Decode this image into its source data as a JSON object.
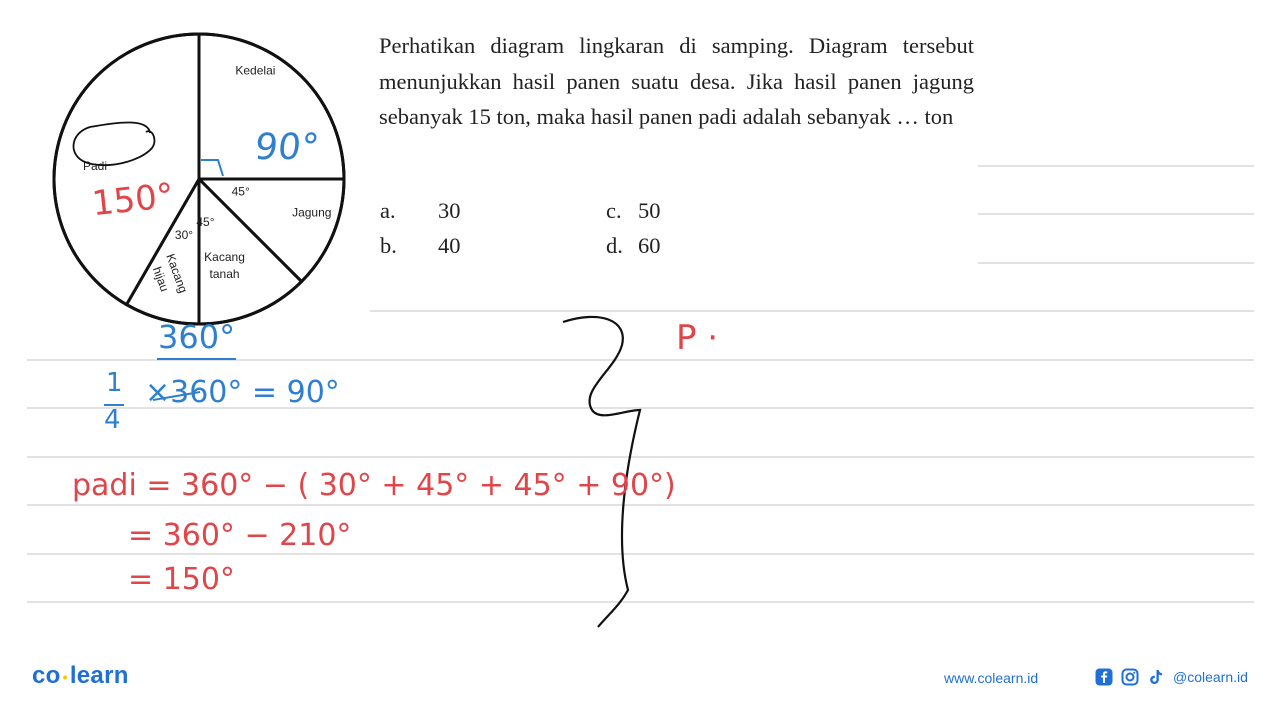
{
  "question": {
    "text": "Perhatikan diagram lingkaran di samping. Diagram tersebut menunjukkan hasil panen suatu desa. Jika hasil panen jagung sebanyak 15 ton, maka hasil panen padi adalah sebanyak … ton",
    "options": [
      {
        "letter": "a.",
        "value": "30"
      },
      {
        "letter": "b.",
        "value": "40"
      },
      {
        "letter": "c.",
        "value": "50"
      },
      {
        "letter": "d.",
        "value": "60"
      }
    ]
  },
  "chart_data": {
    "type": "pie",
    "title": "",
    "unit": "degrees",
    "slices": [
      {
        "label": "Kedelai",
        "angle": 90,
        "angle_label": ""
      },
      {
        "label": "Jagung",
        "angle": 45,
        "angle_label": "45°"
      },
      {
        "label": "Kacang tanah",
        "angle": 45,
        "angle_label": "45°"
      },
      {
        "label": "Kacang hijau",
        "angle": 30,
        "angle_label": "30°"
      },
      {
        "label": "Padi",
        "angle": 150,
        "angle_label": ""
      }
    ]
  },
  "annotations": {
    "kedelai_angle": "90°",
    "padi_angle": "150°",
    "total": "360°",
    "fraction_line": "1/4 × 360° = 90°",
    "fraction_num": "1",
    "fraction_den": "4",
    "fraction_rest": "×360° = 90°",
    "calc_line1": "padi = 360° − ( 30° + 45° + 45° + 90°)",
    "calc_line2": "= 360° − 210°",
    "calc_line3": "= 150°",
    "side_note": "P ·"
  },
  "footer": {
    "logo_left": "co",
    "logo_right": "learn",
    "website": "www.colearn.id",
    "social_handle": "@colearn.id"
  },
  "colors": {
    "ink_blue": "#2f7fd0",
    "ink_red": "#e0454a",
    "brand": "#1f6fd6"
  }
}
